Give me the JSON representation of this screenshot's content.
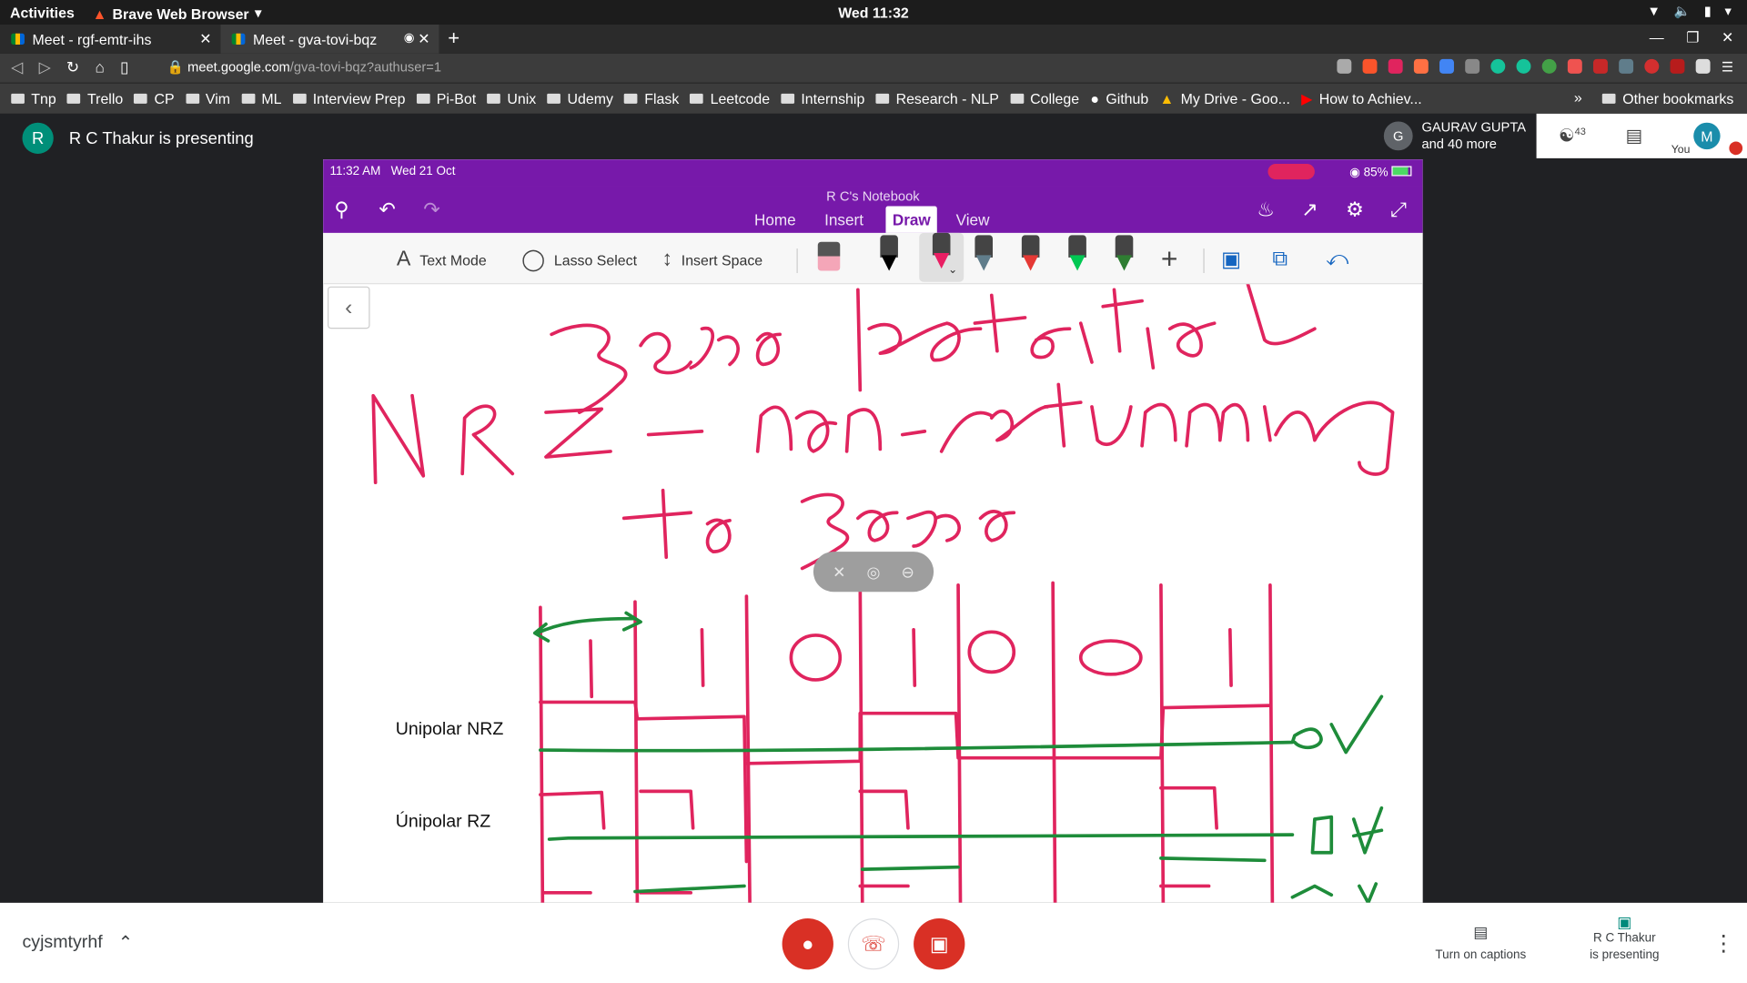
{
  "os": {
    "activities": "Activities",
    "app_name": "Brave Web Browser",
    "clock": "Wed 11:32"
  },
  "browser": {
    "tabs": [
      {
        "title": "Meet - rgf-emtr-ihs"
      },
      {
        "title": "Meet - gva-tovi-bqz"
      }
    ],
    "url_host": "meet.google.com",
    "url_path": "/gva-tovi-bqz?authuser=1",
    "bookmarks": [
      "Tnp",
      "Trello",
      "CP",
      "Vim",
      "ML",
      "Interview Prep",
      "Pi-Bot",
      "Unix",
      "Udemy",
      "Flask",
      "Leetcode",
      "Internship",
      "Research - NLP",
      "College",
      "Github",
      "My Drive - Goo...",
      "How to Achiev..."
    ],
    "other_bookmarks": "Other bookmarks"
  },
  "meet": {
    "presenter_initial": "R",
    "presenter_text": "R C Thakur is presenting",
    "participant_initial": "G",
    "participant_name": "GAURAV GUPTA",
    "participant_more": "and 40 more",
    "people_count": "43",
    "self_initial": "M",
    "self_label": "You",
    "meeting_code": "cyjsmtyrhf",
    "captions_label": "Turn on captions",
    "presenting_label_1": "R C Thakur",
    "presenting_label_2": "is presenting"
  },
  "ipad": {
    "time": "11:32 AM",
    "date": "Wed 21 Oct",
    "battery": "85%"
  },
  "onenote": {
    "notebook_title": "R C's Notebook",
    "tabs": [
      "Home",
      "Insert",
      "Draw",
      "View"
    ],
    "active_tab": "Draw",
    "tools": {
      "text_mode": "Text Mode",
      "lasso": "Lasso Select",
      "insert_space": "Insert Space"
    },
    "pen_colors": [
      "#222222",
      "#e91e63",
      "#607d8b",
      "#e53935",
      "#00c853",
      "#2e7d32"
    ]
  },
  "page": {
    "label_unipolar_nrz": "Unipolar NRZ",
    "label_unipolar_rz": "Únipolar RZ"
  }
}
